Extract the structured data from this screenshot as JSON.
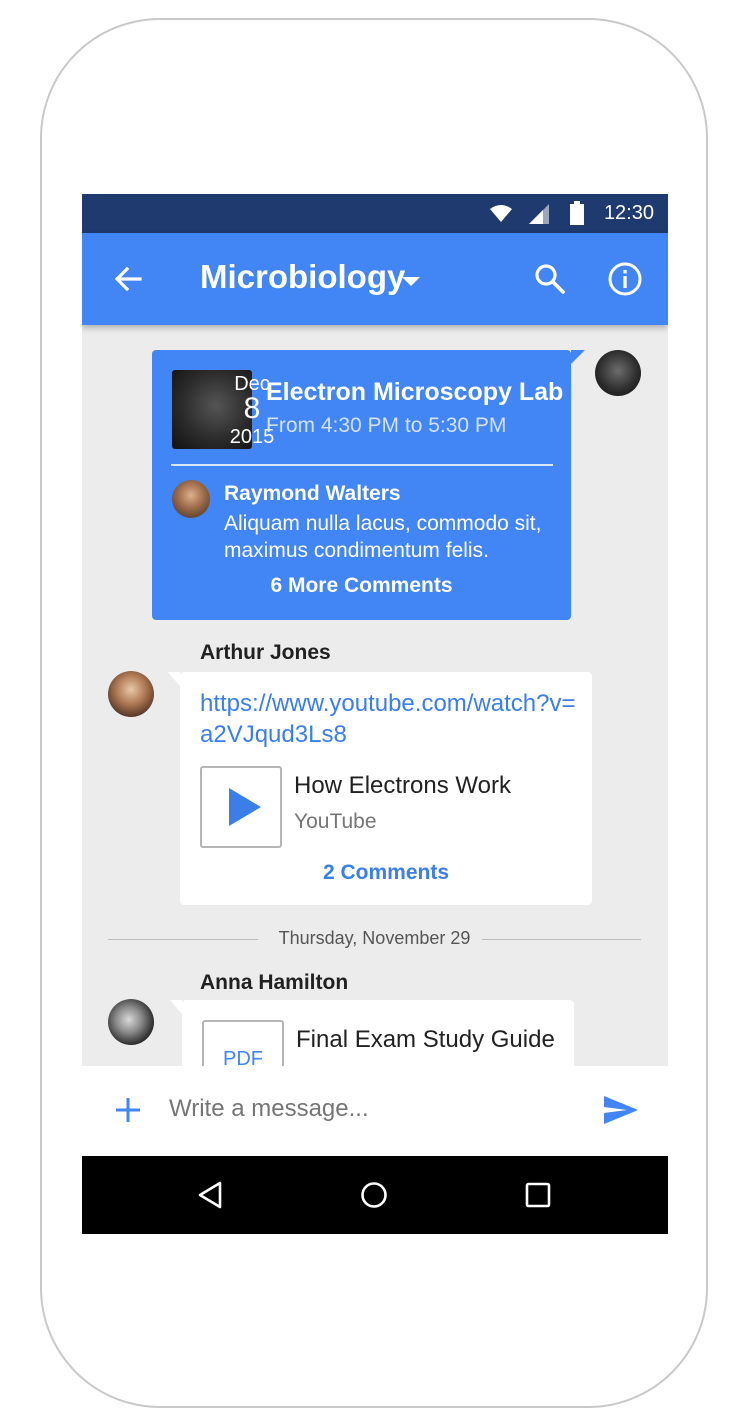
{
  "status_bar": {
    "time": "12:30"
  },
  "app_bar": {
    "title": "Microbiology"
  },
  "event_card": {
    "month": "Dec",
    "day": "8",
    "year": "2015",
    "title": "Electron Microscopy Lab",
    "time_range": "From 4:30 PM to 5:30 PM",
    "comment": {
      "author": "Raymond Walters",
      "text": "Aliquam nulla lacus, commodo sit, maximus condimentum felis."
    },
    "more_comments_label": "6 More Comments"
  },
  "messages": [
    {
      "sender": "Arthur Jones",
      "link": "https://www.youtube.com/watch?v=a2VJqud3Ls8",
      "video_title": "How Electrons Work",
      "video_source": "YouTube",
      "comments_label": "2 Comments"
    },
    {
      "sender": "Anna Hamilton",
      "file_type": "PDF",
      "file_title": "Final Exam Study Guide"
    }
  ],
  "day_separator": "Thursday, November 29",
  "composer": {
    "placeholder": "Write a message..."
  },
  "colors": {
    "primary": "#4285f4",
    "status_bar": "#1e3a6e",
    "link": "#3b7ee8",
    "background": "#ececec"
  },
  "icons": {
    "status": [
      "wifi-icon",
      "signal-icon",
      "battery-icon"
    ],
    "app_bar": [
      "back-arrow-icon",
      "dropdown-caret-icon",
      "search-icon",
      "info-icon"
    ],
    "composer": [
      "plus-icon",
      "send-icon"
    ],
    "navigation": [
      "nav-back-icon",
      "nav-home-icon",
      "nav-recents-icon"
    ]
  }
}
